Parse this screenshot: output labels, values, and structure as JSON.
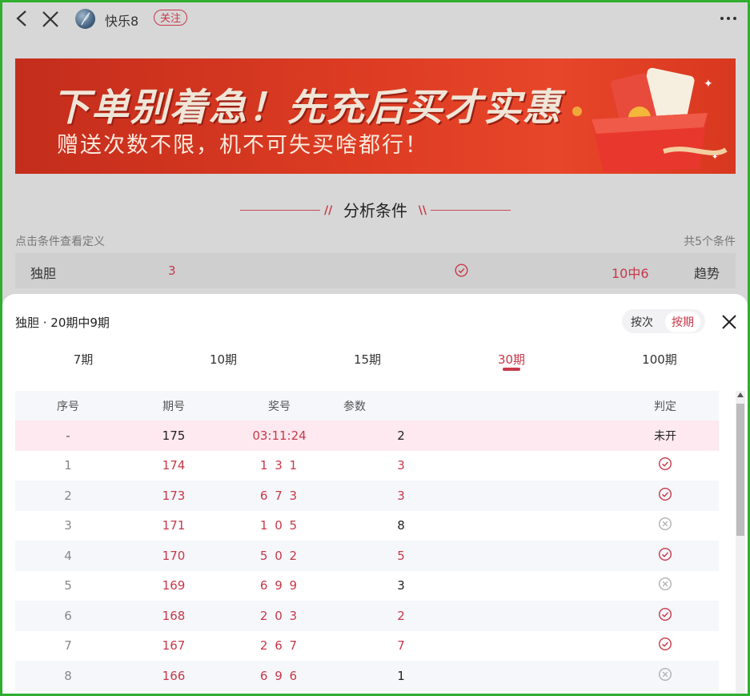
{
  "header": {
    "app_name": "快乐8",
    "follow_label": "关注"
  },
  "banner": {
    "headline": "下单别着急！先充后买才实惠",
    "subline": "赠送次数不限，机不可失买啥都行！"
  },
  "section": {
    "title": "分析条件",
    "hint": "点击条件查看定义",
    "count_text": "共5个条件"
  },
  "condition": {
    "name": "独胆",
    "param": "3",
    "hit_rate": "10中6",
    "trend_label": "趋势"
  },
  "sheet": {
    "title": "独胆 · 20期中9期",
    "toggle_options": [
      "按次",
      "按期"
    ],
    "toggle_selected": "按期",
    "tabs": [
      "7期",
      "10期",
      "15期",
      "30期",
      "100期"
    ],
    "active_tab": "30期"
  },
  "table": {
    "headers": [
      "序号",
      "期号",
      "奖号",
      "参数",
      "判定"
    ],
    "rows": [
      {
        "seq": "-",
        "issue": "175",
        "number": "03:11:24",
        "param": "2",
        "result": "未开",
        "status": "pending"
      },
      {
        "seq": "1",
        "issue": "174",
        "number": "1 3 1",
        "param": "3",
        "status": "hit"
      },
      {
        "seq": "2",
        "issue": "173",
        "number": "6 7 3",
        "param": "3",
        "status": "hit"
      },
      {
        "seq": "3",
        "issue": "171",
        "number": "1 0 5",
        "param": "8",
        "status": "miss"
      },
      {
        "seq": "4",
        "issue": "170",
        "number": "5 0 2",
        "param": "5",
        "status": "hit"
      },
      {
        "seq": "5",
        "issue": "169",
        "number": "6 9 9",
        "param": "3",
        "status": "miss"
      },
      {
        "seq": "6",
        "issue": "168",
        "number": "2 0 3",
        "param": "2",
        "status": "hit"
      },
      {
        "seq": "7",
        "issue": "167",
        "number": "2 6 7",
        "param": "7",
        "status": "hit"
      },
      {
        "seq": "8",
        "issue": "166",
        "number": "6 9 6",
        "param": "1",
        "status": "miss"
      }
    ]
  },
  "colors": {
    "accent": "#c8384a",
    "miss_icon": "#b0b0b0",
    "frame": "#2fae2f"
  }
}
